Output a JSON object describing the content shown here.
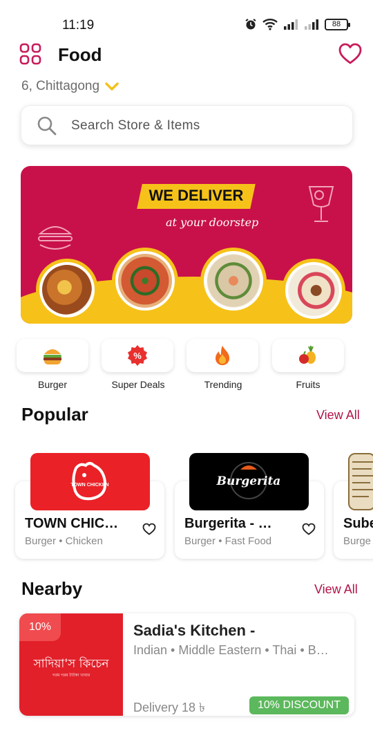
{
  "status_bar": {
    "time": "11:19",
    "battery": "88"
  },
  "header": {
    "title": "Food",
    "location": "6, Chittagong"
  },
  "search": {
    "placeholder": "Search Store & Items"
  },
  "banner": {
    "headline": "WE DELIVER",
    "subline": "at your doorstep"
  },
  "categories": [
    {
      "label": "Burger",
      "icon": "burger-icon"
    },
    {
      "label": "Super Deals",
      "icon": "discount-icon"
    },
    {
      "label": "Trending",
      "icon": "flame-icon"
    },
    {
      "label": "Fruits",
      "icon": "fruits-icon"
    }
  ],
  "popular": {
    "title": "Popular",
    "view_all": "View All",
    "items": [
      {
        "name": "TOWN CHIC…",
        "tags": "Burger • Chicken",
        "logo_text": "TOWN CHICKEN"
      },
      {
        "name": "Burgerita - …",
        "tags": "Burger • Fast Food",
        "logo_text": "Burgerita"
      },
      {
        "name": "Sube",
        "tags": "Burge"
      }
    ]
  },
  "nearby": {
    "title": "Nearby",
    "view_all": "View All",
    "items": [
      {
        "badge": "10%",
        "brand_text": "সাদিয়া'স কিচেন",
        "brand_subtext": "গরম গরম টাটকা খাবার",
        "name": "Sadia's Kitchen -",
        "cuisine": "Indian • Middle Eastern • Thai • B…",
        "delivery": "Delivery 18 ৳",
        "discount": "10% DISCOUNT"
      }
    ]
  },
  "colors": {
    "accent": "#b0124a",
    "banner_red": "#c8114a",
    "banner_yellow": "#f6c21a",
    "discount_green": "#5cb85c"
  }
}
